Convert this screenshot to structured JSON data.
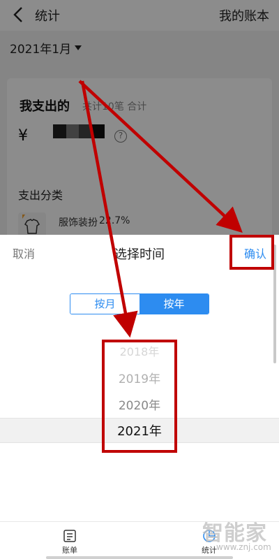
{
  "header": {
    "title": "统计",
    "right_link": "我的账本"
  },
  "filter": {
    "month_label": "2021年1月"
  },
  "summary": {
    "title": "我支出的",
    "subtitle": "共计10笔 合计",
    "currency": "¥",
    "help": "?",
    "category_heading": "支出分类",
    "category": {
      "name": "服饰装扮",
      "percent": "22.7%",
      "currency": "¥"
    }
  },
  "sheet": {
    "cancel": "取消",
    "title": "选择时间",
    "confirm": "确认",
    "segments": {
      "month": "按月",
      "year": "按年"
    },
    "years": [
      "2018年",
      "2019年",
      "2020年",
      "2021年"
    ]
  },
  "tabbar": {
    "bill": "账单",
    "stats": "统计"
  },
  "watermark": {
    "name": "智能家",
    "url": "www.znj.com"
  },
  "colors": {
    "accent": "#2d8cf0",
    "annotation": "#c00000"
  }
}
